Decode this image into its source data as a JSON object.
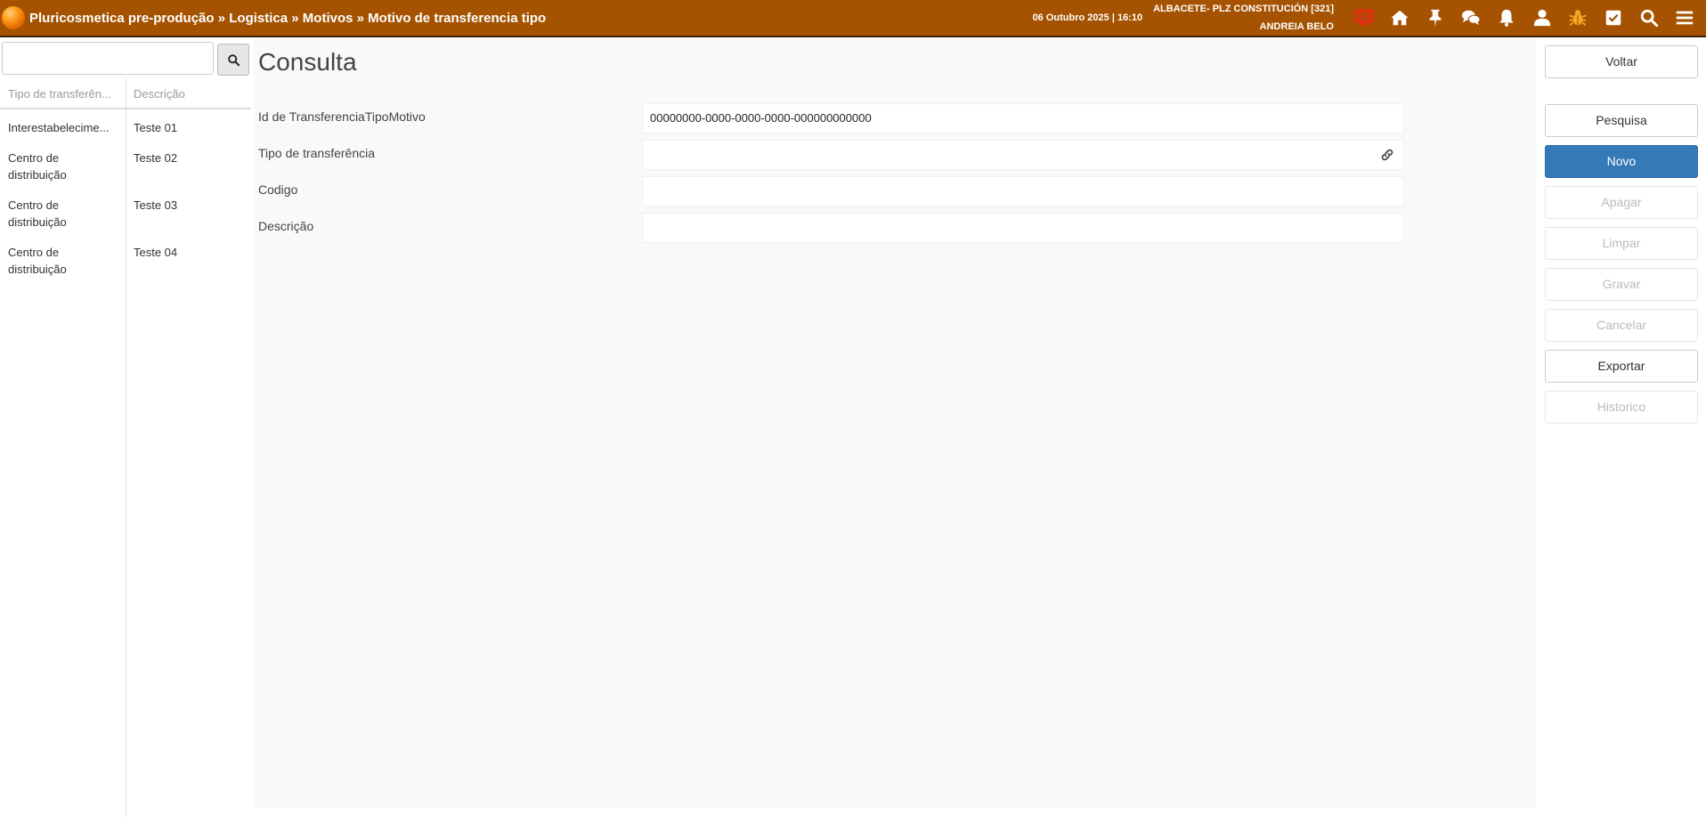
{
  "header": {
    "breadcrumb": [
      "Pluricosmetica pre-produção",
      "Logistica",
      "Motivos",
      "Motivo de transferencia tipo"
    ],
    "separator": " » ",
    "datetime": "06 Outubro 2025 | 16:10",
    "store": "ALBACETE- PLZ CONSTITUCIÓN [321]",
    "user": "ANDREIA BELO",
    "icons": [
      "monitor-icon",
      "home-icon",
      "pin-icon",
      "chat-icon",
      "bell-icon",
      "user-icon",
      "bug-icon",
      "checkbox-icon",
      "search-icon",
      "menu-icon"
    ],
    "colors": {
      "bar": "#a55300",
      "monitor": "#ff1a1a",
      "bug": "#f5a623"
    }
  },
  "sidebar": {
    "search": {
      "value": "",
      "placeholder": ""
    },
    "columns": [
      "Tipo de transferên...",
      "Descrição"
    ],
    "rows": [
      {
        "tipo": "Interestabelecime...",
        "descricao": "Teste 01"
      },
      {
        "tipo": "Centro de distribuição",
        "descricao": "Teste 02"
      },
      {
        "tipo": "Centro de distribuição",
        "descricao": "Teste 03"
      },
      {
        "tipo": "Centro de distribuição",
        "descricao": "Teste 04"
      }
    ]
  },
  "main": {
    "title": "Consulta",
    "fields": [
      {
        "label": "Id de TransferenciaTipoMotivo",
        "value": "00000000-0000-0000-0000-000000000000"
      },
      {
        "label": "Tipo de transferência",
        "value": ""
      },
      {
        "label": "Codigo",
        "value": ""
      },
      {
        "label": "Descrição",
        "value": ""
      }
    ]
  },
  "actions": {
    "voltar": "Voltar",
    "pesquisa": "Pesquisa",
    "novo": "Novo",
    "apagar": "Apagar",
    "limpar": "Limpar",
    "gravar": "Gravar",
    "cancelar": "Cancelar",
    "exportar": "Exportar",
    "historico": "Historico",
    "primary_color": "#337ab7"
  }
}
